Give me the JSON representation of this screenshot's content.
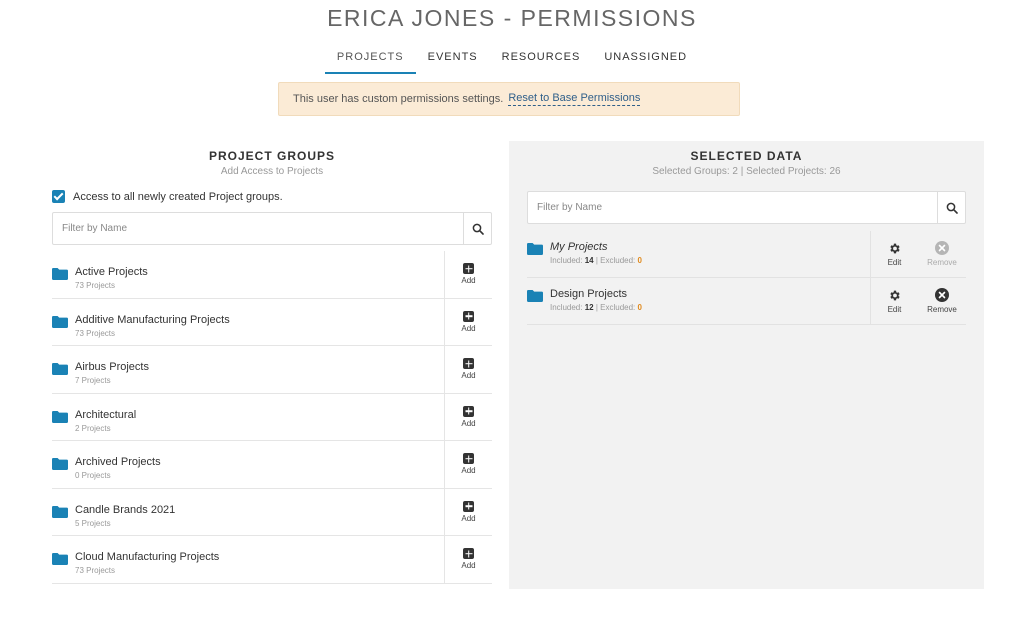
{
  "page": {
    "title": "ERICA JONES - PERMISSIONS"
  },
  "tabs": [
    {
      "label": "PROJECTS",
      "active": true
    },
    {
      "label": "EVENTS",
      "active": false
    },
    {
      "label": "RESOURCES",
      "active": false
    },
    {
      "label": "UNASSIGNED",
      "active": false
    }
  ],
  "alert": {
    "text": "This user has custom permissions settings.",
    "link": "Reset to Base Permissions"
  },
  "project_groups": {
    "title": "PROJECT GROUPS",
    "subtitle": "Add Access to Projects",
    "checkbox_label": "Access to all newly created Project groups.",
    "checkbox_checked": true,
    "filter_placeholder": "Filter by Name",
    "add_label": "Add",
    "items": [
      {
        "name": "Active Projects",
        "count": "73 Projects"
      },
      {
        "name": "Additive Manufacturing Projects",
        "count": "73 Projects"
      },
      {
        "name": "Airbus Projects",
        "count": "7 Projects"
      },
      {
        "name": "Architectural",
        "count": "2 Projects"
      },
      {
        "name": "Archived Projects",
        "count": "0 Projects"
      },
      {
        "name": "Candle Brands 2021",
        "count": "5 Projects"
      },
      {
        "name": "Cloud Manufacturing Projects",
        "count": "73 Projects"
      }
    ]
  },
  "selected_data": {
    "title": "SELECTED DATA",
    "subtitle": "Selected Groups: 2 | Selected Projects: 26",
    "filter_placeholder": "Filter by Name",
    "edit_label": "Edit",
    "remove_label": "Remove",
    "included_label": "Included:",
    "excluded_label": "| Excluded:",
    "items": [
      {
        "name": "My Projects",
        "included": "14",
        "excluded": "0",
        "italic": true,
        "remove_enabled": false
      },
      {
        "name": "Design Projects",
        "included": "12",
        "excluded": "0",
        "italic": false,
        "remove_enabled": true
      }
    ]
  },
  "colors": {
    "accent": "#1a82b5",
    "alert_bg": "#fbebd6",
    "excluded": "#e08a1e",
    "panel_bg": "#f2f2f2"
  },
  "icons": [
    "folder-icon",
    "search-icon",
    "add-icon",
    "gear-icon",
    "remove-icon",
    "checkbox-checked-icon"
  ]
}
